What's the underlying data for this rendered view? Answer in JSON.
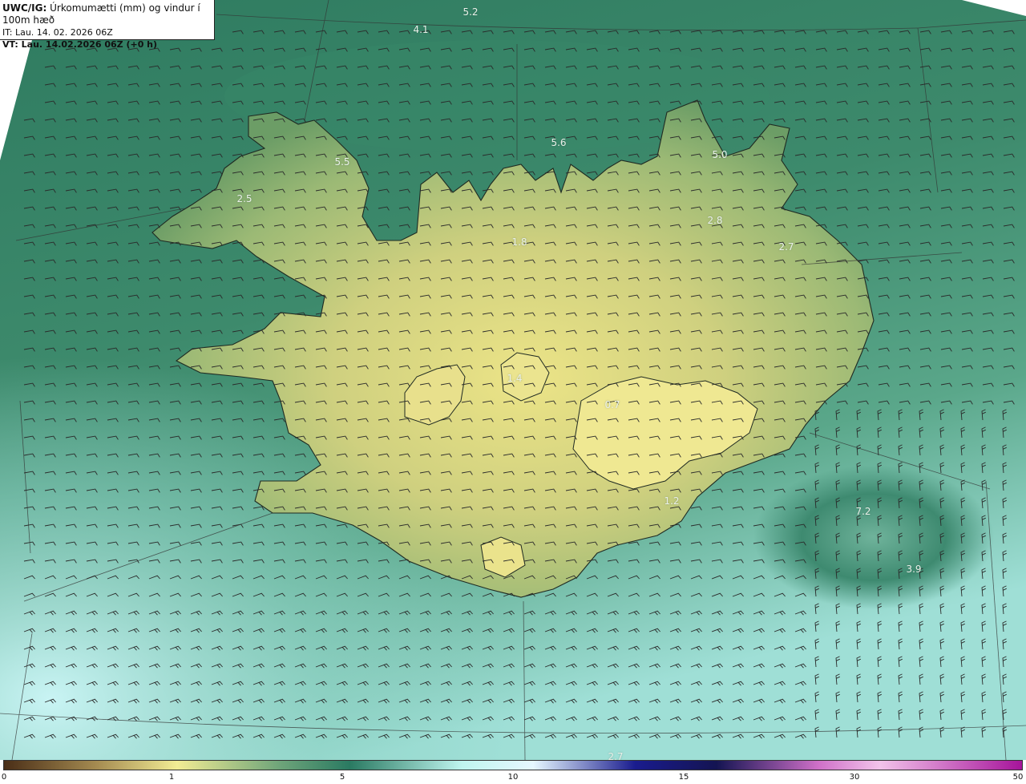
{
  "header": {
    "model": "UWC/IG:",
    "product": "Úrkomumætti (mm) og vindur í 100m hæð",
    "init_time": "IT: Lau. 14. 02. 2026 06Z",
    "valid_time": "VT: Lau. 14.02.2026 06Z (+0 h)"
  },
  "map_labels": [
    "5.2",
    "4.1",
    "5.5",
    "5.6",
    "5.0",
    "2.5",
    "2.8",
    "2.7",
    "1.8",
    "1.4",
    "0.7",
    "1.2",
    "7.2",
    "3.9",
    "2.7"
  ],
  "colorbar": {
    "ticks": [
      "0",
      "1",
      "5",
      "10",
      "15",
      "30",
      "50"
    ],
    "colors": [
      "#4a2e17",
      "#a48a50",
      "#f2ec94",
      "#6fa57a",
      "#2a7a62",
      "#bff5ef",
      "#e6f7ff",
      "#1a1c8e",
      "#141452",
      "#cf70c8",
      "#f2c3ea",
      "#a6149a"
    ]
  },
  "palette": {
    "ocean_dark": "#2b7058",
    "ocean_mid": "#3f8a6e",
    "ocean_light": "#8fd1c6",
    "ocean_pale": "#c8f3f2",
    "land_low": "#6d9e63",
    "land_high": "#e6df86"
  }
}
